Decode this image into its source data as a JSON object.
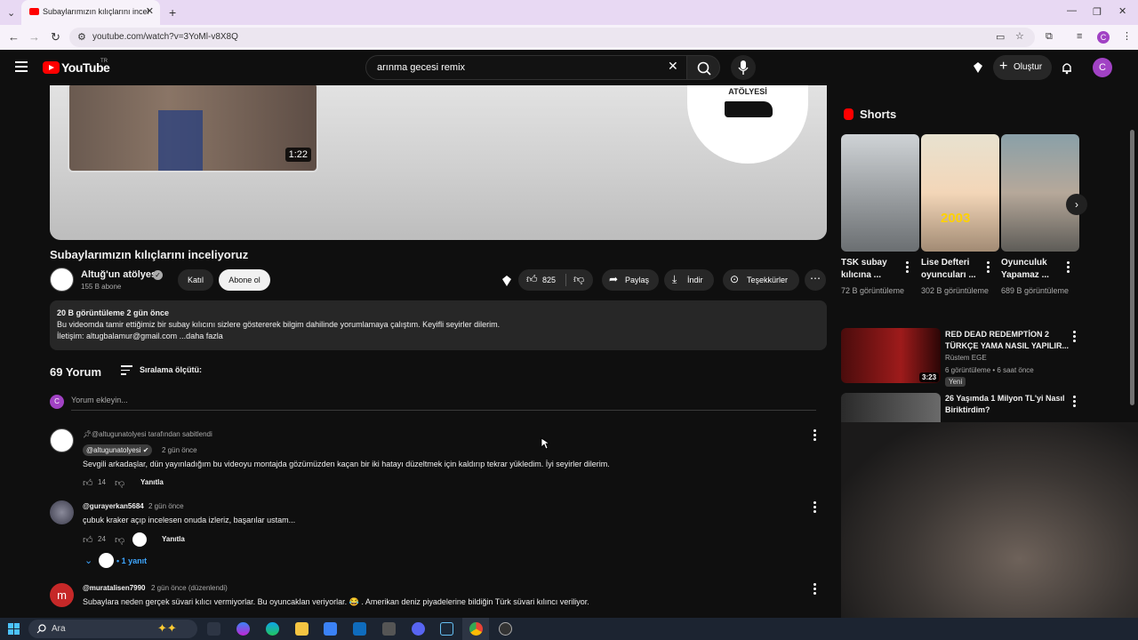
{
  "browser": {
    "tab_title": "Subaylarımızın kılıçlarını inceliyoruz",
    "url": "youtube.com/watch?v=3YoMl-v8X8Q",
    "profile_letter": "C"
  },
  "header": {
    "logo": "YouTube",
    "region": "TR",
    "search_query": "arınma gecesi remix",
    "create_label": "Oluştur",
    "avatar_letter": "C"
  },
  "player": {
    "thumb_duration": "1:22",
    "logo_text": "ATÖLYESİ"
  },
  "video": {
    "title": "Subaylarımızın kılıçlarını inceliyoruz",
    "channel": "Altuğ'un atölyesi",
    "subscribers": "155 B abone",
    "join": "Katıl",
    "subscribe": "Abone ol",
    "likes": "825",
    "share": "Paylaş",
    "download": "İndir",
    "thanks": "Teşekkürler"
  },
  "description": {
    "meta": "20 B görüntüleme  2 gün önce",
    "line1": "Bu videomda tamir ettiğimiz bir subay kılıcını sizlere göstererek bilgim dahilinde yorumlamaya çalıştım. Keyifli seyirler dilerim.",
    "line2": "İletişim: altugbalamur@gmail.com ...daha fazla"
  },
  "comments": {
    "count": "69 Yorum",
    "sort": "Sıralama ölçütü:",
    "placeholder": "Yorum ekleyin...",
    "my_avatar": "C",
    "items": [
      {
        "pinned_by": "@altugunatolyesi tarafından sabitlendi",
        "author": "@altugunatolyesi",
        "time": "2 gün önce",
        "text": "Sevgili arkadaşlar, dün yayınladığım bu videoyu montajda gözümüzden kaçan bir iki hatayı düzeltmek için kaldırıp tekrar yükledim. İyi seyirler dilerim.",
        "likes": "14",
        "reply": "Yanıtla"
      },
      {
        "author": "@gurayerkan5684",
        "time": "2 gün önce",
        "text": "çubuk kraker açıp incelesen onuda izleriz, başarılar ustam...",
        "likes": "24",
        "reply": "Yanıtla",
        "replies": "1 yanıt"
      },
      {
        "avatar_letter": "m",
        "author": "@muratalisen7990",
        "time": "2 gün önce (düzenlendi)",
        "text": "Subaylara neden gerçek süvari kılıcı vermiyorlar. Bu oyuncaklan veriyorlar. 😂 . Amerikan deniz piyadelerine bildiğin Türk süvari kılıncı veriliyor."
      }
    ]
  },
  "sidebar": {
    "shorts_title": "Shorts",
    "shorts": [
      {
        "title": "TSK subay kılıcına ...",
        "views": "72 B görüntüleme"
      },
      {
        "title": "Lise Defteri oyuncuları ...",
        "views": "302 B görüntüleme",
        "overlay": "2003"
      },
      {
        "title": "Oyunculuk Yapamaz ...",
        "views": "689 B görüntüleme"
      }
    ],
    "recommended": [
      {
        "title": "RED DEAD REDEMPTİON 2 TÜRKÇE YAMA NASIL YAPILIR...",
        "channel": "Rüstem EGE",
        "meta": "6 görüntüleme • 6 saat önce",
        "badge": "Yeni",
        "duration": "3:23"
      },
      {
        "title": "26 Yaşımda 1 Milyon TL'yi Nasıl Biriktirdim?"
      }
    ]
  },
  "taskbar": {
    "search_label": "Ara"
  },
  "colors": {
    "bg": "#0f0f0f",
    "surface": "#272727",
    "brand_red": "#ff0000",
    "avatar_purple": "#a142c4"
  }
}
